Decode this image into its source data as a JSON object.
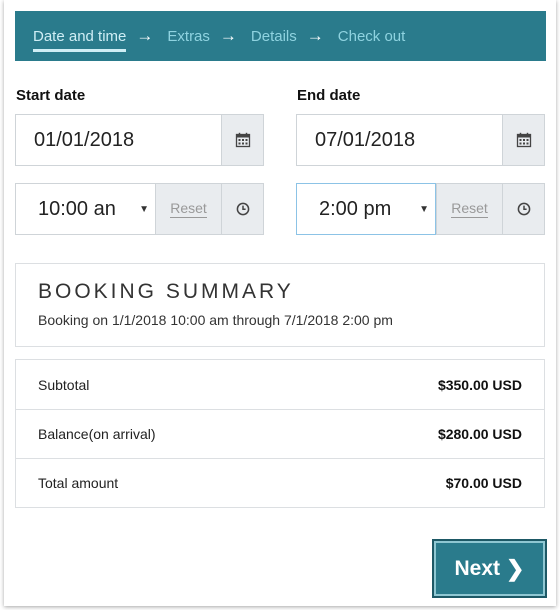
{
  "steps": [
    {
      "label": "Date and time"
    },
    {
      "label": "Extras"
    },
    {
      "label": "Details"
    },
    {
      "label": "Check out"
    }
  ],
  "arrow_glyph": "→",
  "start": {
    "label": "Start date",
    "date": "01/01/2018",
    "time": "10:00 an",
    "reset": "Reset"
  },
  "end": {
    "label": "End date",
    "date": "07/01/2018",
    "time": "2:00 pm",
    "reset": "Reset"
  },
  "icons": {
    "calendar": "calendar-icon",
    "clock": "clock-icon",
    "caret": "▼"
  },
  "summary": {
    "title": "BOOKING SUMMARY",
    "text": "Booking on 1/1/2018 10:00 am through 7/1/2018 2:00 pm"
  },
  "totals": [
    {
      "label": "Subtotal",
      "value": "$350.00 USD"
    },
    {
      "label": "Balance(on arrival)",
      "value": "$280.00 USD"
    },
    {
      "label": "Total amount",
      "value": "$70.00 USD"
    }
  ],
  "next": {
    "label": "Next",
    "chevron": "❯"
  },
  "colors": {
    "accent": "#2a7b8c",
    "step_text": "#8fd3e0",
    "addon_bg": "#e9ecef"
  }
}
